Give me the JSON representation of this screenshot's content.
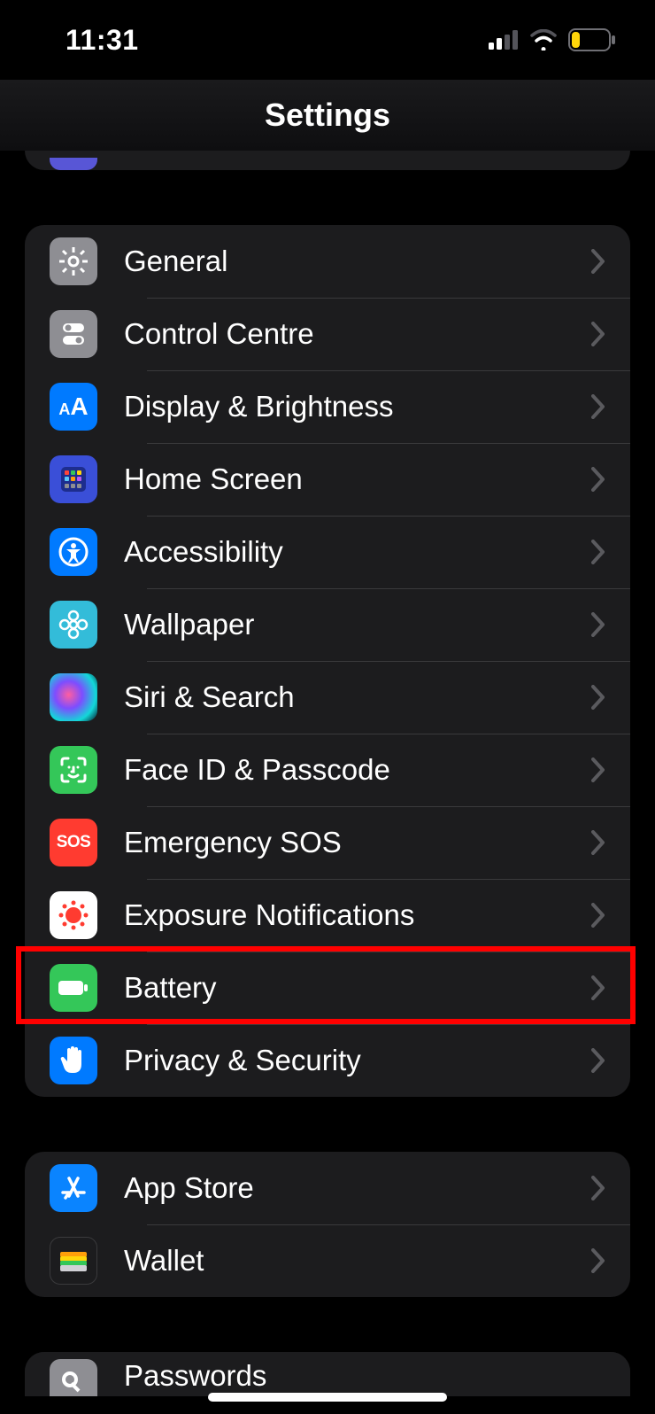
{
  "status": {
    "time": "11:31"
  },
  "nav": {
    "title": "Settings"
  },
  "groups": [
    {
      "id": "g1",
      "rows": [
        {
          "id": "general",
          "label": "General",
          "icon": "gear-icon",
          "bg": "#8e8e93"
        },
        {
          "id": "control-centre",
          "label": "Control Centre",
          "icon": "switches-icon",
          "bg": "#8e8e93"
        },
        {
          "id": "display",
          "label": "Display & Brightness",
          "icon": "text-size-icon",
          "bg": "#007aff"
        },
        {
          "id": "home-screen",
          "label": "Home Screen",
          "icon": "home-grid-icon",
          "bg": "#2f54eb"
        },
        {
          "id": "accessibility",
          "label": "Accessibility",
          "icon": "accessibility-icon",
          "bg": "#007aff"
        },
        {
          "id": "wallpaper",
          "label": "Wallpaper",
          "icon": "flower-icon",
          "bg": "#33bcd9"
        },
        {
          "id": "siri",
          "label": "Siri & Search",
          "icon": "siri-icon",
          "bg": "#000000"
        },
        {
          "id": "faceid",
          "label": "Face ID & Passcode",
          "icon": "faceid-icon",
          "bg": "#34c759"
        },
        {
          "id": "sos",
          "label": "Emergency SOS",
          "icon": "sos-icon",
          "bg": "#ff3b30"
        },
        {
          "id": "exposure",
          "label": "Exposure Notifications",
          "icon": "exposure-icon",
          "bg": "#ffffff"
        },
        {
          "id": "battery",
          "label": "Battery",
          "icon": "battery-icon",
          "bg": "#34c759",
          "highlighted": true
        },
        {
          "id": "privacy",
          "label": "Privacy & Security",
          "icon": "hand-icon",
          "bg": "#007aff"
        }
      ]
    },
    {
      "id": "g2",
      "rows": [
        {
          "id": "app-store",
          "label": "App Store",
          "icon": "appstore-icon",
          "bg": "#007aff"
        },
        {
          "id": "wallet",
          "label": "Wallet",
          "icon": "wallet-icon",
          "bg": "#1c1c1e"
        }
      ]
    }
  ],
  "partial_bottom": {
    "label": "Passwords",
    "icon": "key-icon",
    "bg": "#8e8e93"
  }
}
